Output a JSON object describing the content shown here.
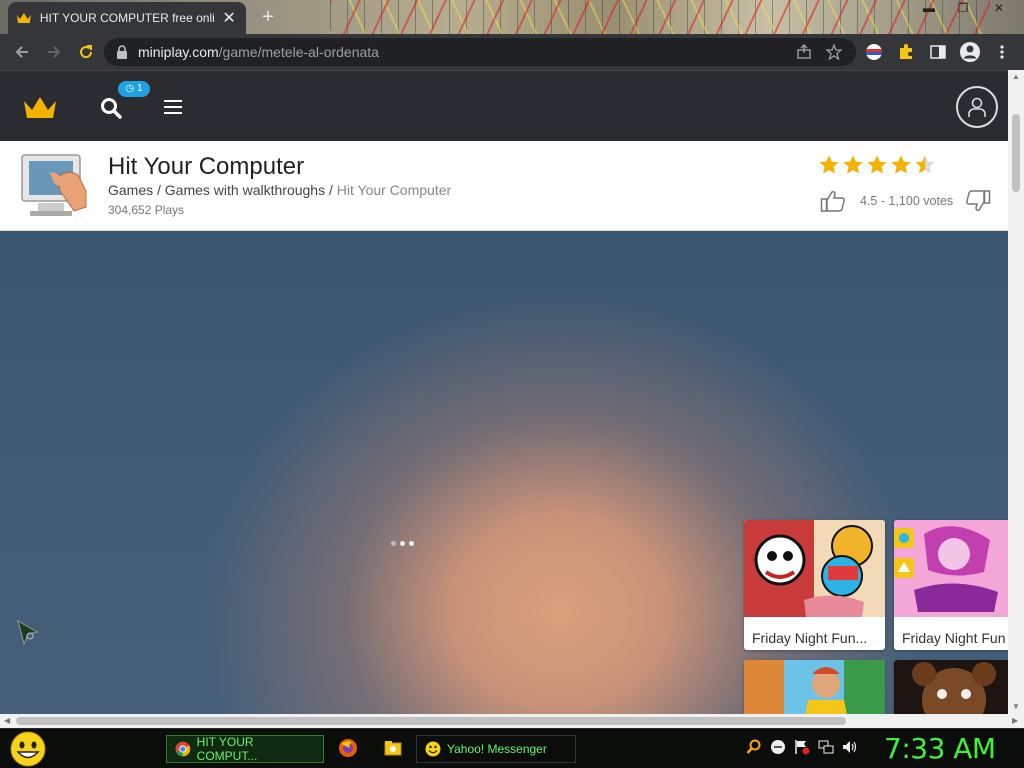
{
  "browser": {
    "tab_title": "HIT YOUR COMPUTER free onlin",
    "tab_close": "✕",
    "new_tab": "+",
    "url_host": "miniplay.com",
    "url_path": "/game/metele-al-ordenata"
  },
  "site": {
    "notification_count": "1",
    "game": {
      "title": "Hit Your Computer",
      "crumb_games": "Games",
      "crumb_sep1": " / ",
      "crumb_category": "Games with walkthroughs",
      "crumb_sep2": " / ",
      "crumb_current": "Hit Your Computer",
      "plays": "304,652 Plays",
      "rating": 4.5,
      "max_rating": 5,
      "votes_text": "4.5 - 1,100 votes"
    },
    "related_games": [
      {
        "label": "Friday Night Fun..."
      },
      {
        "label": "Friday Night Fun"
      },
      {
        "label": ""
      },
      {
        "label": ""
      }
    ]
  },
  "taskbar": {
    "tasks": [
      {
        "label": "HIT YOUR COMPUT..."
      },
      {
        "label": "Yahoo! Messenger"
      }
    ],
    "clock": "7:33 AM"
  },
  "colors": {
    "browser_chrome": "#35363a",
    "site_header": "#2a2c31",
    "star": "#f5b301",
    "badge": "#1fa3e0",
    "clock_green": "#3ef23e"
  }
}
